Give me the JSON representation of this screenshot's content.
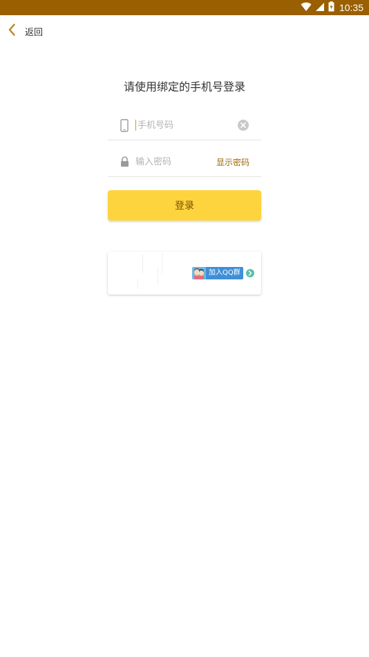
{
  "status_bar": {
    "time": "10:35",
    "background": "#9a5f00"
  },
  "header": {
    "back_label": "返回"
  },
  "login": {
    "title": "请使用绑定的手机号登录",
    "phone_placeholder": "手机号码",
    "password_placeholder": "输入密码",
    "show_password_label": "显示密码",
    "login_button_label": "登录"
  },
  "ad": {
    "qq_group_label": "加入QQ群"
  },
  "icons": {
    "back": "chevron-left-icon",
    "phone": "phone-icon",
    "lock": "lock-icon",
    "clear": "clear-icon",
    "wifi": "wifi-icon",
    "signal": "signal-icon",
    "battery": "battery-icon",
    "arrow": "chevron-right-icon"
  },
  "colors": {
    "accent": "#fdd43d",
    "accent_text": "#9a6a0a",
    "back_chevron": "#b8862a"
  }
}
